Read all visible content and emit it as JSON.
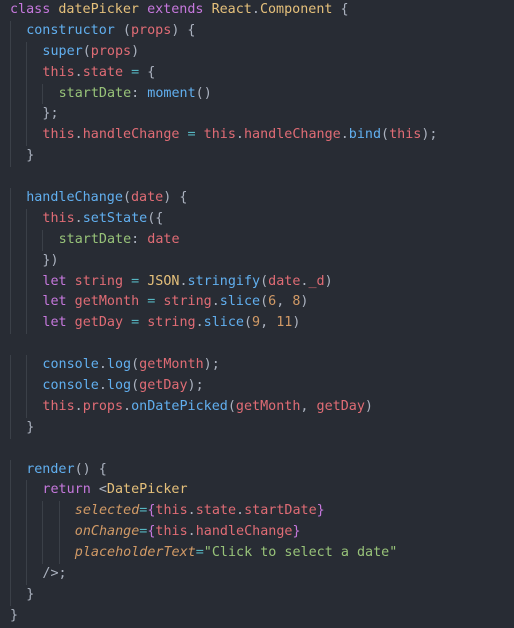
{
  "colors": {
    "background": "#282c34",
    "keyword": "#c678dd",
    "class": "#e5c07b",
    "function": "#61afef",
    "variable": "#e06c75",
    "punctuation": "#abb2bf",
    "property": "#98c379",
    "number": "#d19a66",
    "string": "#98c379",
    "attribute": "#d19a66",
    "operator": "#56b6c2"
  },
  "lines": [
    {
      "indent": 0,
      "tokens": [
        [
          "k",
          "class"
        ],
        [
          "p",
          " "
        ],
        [
          "cls",
          "datePicker"
        ],
        [
          "p",
          " "
        ],
        [
          "k",
          "extends"
        ],
        [
          "p",
          " "
        ],
        [
          "cls",
          "React"
        ],
        [
          "p",
          "."
        ],
        [
          "cls",
          "Component"
        ],
        [
          "p",
          " {"
        ]
      ]
    },
    {
      "indent": 1,
      "tokens": [
        [
          "fn",
          "constructor"
        ],
        [
          "p",
          " ("
        ],
        [
          "v",
          "props"
        ],
        [
          "p",
          ") {"
        ]
      ]
    },
    {
      "indent": 2,
      "tokens": [
        [
          "fn",
          "super"
        ],
        [
          "p",
          "("
        ],
        [
          "v",
          "props"
        ],
        [
          "p",
          ")"
        ]
      ]
    },
    {
      "indent": 2,
      "tokens": [
        [
          "v",
          "this"
        ],
        [
          "p",
          "."
        ],
        [
          "v",
          "state"
        ],
        [
          "p",
          " "
        ],
        [
          "op",
          "="
        ],
        [
          "p",
          " {"
        ]
      ]
    },
    {
      "indent": 3,
      "tokens": [
        [
          "prop",
          "startDate"
        ],
        [
          "p",
          ": "
        ],
        [
          "fn",
          "moment"
        ],
        [
          "p",
          "()"
        ]
      ]
    },
    {
      "indent": 2,
      "tokens": [
        [
          "p",
          "};"
        ]
      ]
    },
    {
      "indent": 2,
      "tokens": [
        [
          "v",
          "this"
        ],
        [
          "p",
          "."
        ],
        [
          "v",
          "handleChange"
        ],
        [
          "p",
          " "
        ],
        [
          "op",
          "="
        ],
        [
          "p",
          " "
        ],
        [
          "v",
          "this"
        ],
        [
          "p",
          "."
        ],
        [
          "v",
          "handleChange"
        ],
        [
          "p",
          "."
        ],
        [
          "fn",
          "bind"
        ],
        [
          "p",
          "("
        ],
        [
          "v",
          "this"
        ],
        [
          "p",
          ");"
        ]
      ]
    },
    {
      "indent": 1,
      "tokens": [
        [
          "p",
          "}"
        ]
      ]
    },
    {
      "indent": 0,
      "tokens": []
    },
    {
      "indent": 1,
      "tokens": [
        [
          "fn",
          "handleChange"
        ],
        [
          "p",
          "("
        ],
        [
          "v",
          "date"
        ],
        [
          "p",
          ") {"
        ]
      ]
    },
    {
      "indent": 2,
      "tokens": [
        [
          "v",
          "this"
        ],
        [
          "p",
          "."
        ],
        [
          "fn",
          "setState"
        ],
        [
          "p",
          "({"
        ]
      ]
    },
    {
      "indent": 3,
      "tokens": [
        [
          "prop",
          "startDate"
        ],
        [
          "p",
          ": "
        ],
        [
          "v",
          "date"
        ]
      ]
    },
    {
      "indent": 2,
      "tokens": [
        [
          "p",
          "})"
        ]
      ]
    },
    {
      "indent": 2,
      "tokens": [
        [
          "k",
          "let"
        ],
        [
          "p",
          " "
        ],
        [
          "v",
          "string"
        ],
        [
          "p",
          " "
        ],
        [
          "op",
          "="
        ],
        [
          "p",
          " "
        ],
        [
          "cls",
          "JSON"
        ],
        [
          "p",
          "."
        ],
        [
          "fn",
          "stringify"
        ],
        [
          "p",
          "("
        ],
        [
          "v",
          "date"
        ],
        [
          "p",
          "."
        ],
        [
          "v",
          "_d"
        ],
        [
          "p",
          ")"
        ]
      ]
    },
    {
      "indent": 2,
      "tokens": [
        [
          "k",
          "let"
        ],
        [
          "p",
          " "
        ],
        [
          "v",
          "getMonth"
        ],
        [
          "p",
          " "
        ],
        [
          "op",
          "="
        ],
        [
          "p",
          " "
        ],
        [
          "v",
          "string"
        ],
        [
          "p",
          "."
        ],
        [
          "fn",
          "slice"
        ],
        [
          "p",
          "("
        ],
        [
          "num",
          "6"
        ],
        [
          "p",
          ", "
        ],
        [
          "num",
          "8"
        ],
        [
          "p",
          ")"
        ]
      ]
    },
    {
      "indent": 2,
      "tokens": [
        [
          "k",
          "let"
        ],
        [
          "p",
          " "
        ],
        [
          "v",
          "getDay"
        ],
        [
          "p",
          " "
        ],
        [
          "op",
          "="
        ],
        [
          "p",
          " "
        ],
        [
          "v",
          "string"
        ],
        [
          "p",
          "."
        ],
        [
          "fn",
          "slice"
        ],
        [
          "p",
          "("
        ],
        [
          "num",
          "9"
        ],
        [
          "p",
          ", "
        ],
        [
          "num",
          "11"
        ],
        [
          "p",
          ")"
        ]
      ]
    },
    {
      "indent": 0,
      "tokens": []
    },
    {
      "indent": 2,
      "tokens": [
        [
          "fn",
          "console"
        ],
        [
          "p",
          "."
        ],
        [
          "fn",
          "log"
        ],
        [
          "p",
          "("
        ],
        [
          "v",
          "getMonth"
        ],
        [
          "p",
          ");"
        ]
      ]
    },
    {
      "indent": 2,
      "tokens": [
        [
          "fn",
          "console"
        ],
        [
          "p",
          "."
        ],
        [
          "fn",
          "log"
        ],
        [
          "p",
          "("
        ],
        [
          "v",
          "getDay"
        ],
        [
          "p",
          ");"
        ]
      ]
    },
    {
      "indent": 2,
      "tokens": [
        [
          "v",
          "this"
        ],
        [
          "p",
          "."
        ],
        [
          "v",
          "props"
        ],
        [
          "p",
          "."
        ],
        [
          "fn",
          "onDatePicked"
        ],
        [
          "p",
          "("
        ],
        [
          "v",
          "getMonth"
        ],
        [
          "p",
          ", "
        ],
        [
          "v",
          "getDay"
        ],
        [
          "p",
          ")"
        ]
      ]
    },
    {
      "indent": 1,
      "tokens": [
        [
          "p",
          "}"
        ]
      ]
    },
    {
      "indent": 0,
      "tokens": []
    },
    {
      "indent": 1,
      "tokens": [
        [
          "fn",
          "render"
        ],
        [
          "p",
          "() {"
        ]
      ]
    },
    {
      "indent": 2,
      "tokens": [
        [
          "k",
          "return"
        ],
        [
          "p",
          " <"
        ],
        [
          "tag",
          "DatePicker"
        ]
      ]
    },
    {
      "indent": 4,
      "tokens": [
        [
          "attr",
          "selected"
        ],
        [
          "op",
          "="
        ],
        [
          "k",
          "{"
        ],
        [
          "v",
          "this"
        ],
        [
          "p",
          "."
        ],
        [
          "v",
          "state"
        ],
        [
          "p",
          "."
        ],
        [
          "v",
          "startDate"
        ],
        [
          "k",
          "}"
        ]
      ]
    },
    {
      "indent": 4,
      "tokens": [
        [
          "attr",
          "onChange"
        ],
        [
          "op",
          "="
        ],
        [
          "k",
          "{"
        ],
        [
          "v",
          "this"
        ],
        [
          "p",
          "."
        ],
        [
          "v",
          "handleChange"
        ],
        [
          "k",
          "}"
        ]
      ]
    },
    {
      "indent": 4,
      "tokens": [
        [
          "attr",
          "placeholderText"
        ],
        [
          "op",
          "="
        ],
        [
          "str",
          "\"Click to select a date\""
        ]
      ]
    },
    {
      "indent": 2,
      "tokens": [
        [
          "p",
          "/>;"
        ]
      ]
    },
    {
      "indent": 1,
      "tokens": [
        [
          "p",
          "}"
        ]
      ]
    },
    {
      "indent": 0,
      "tokens": [
        [
          "p",
          "}"
        ]
      ]
    }
  ]
}
